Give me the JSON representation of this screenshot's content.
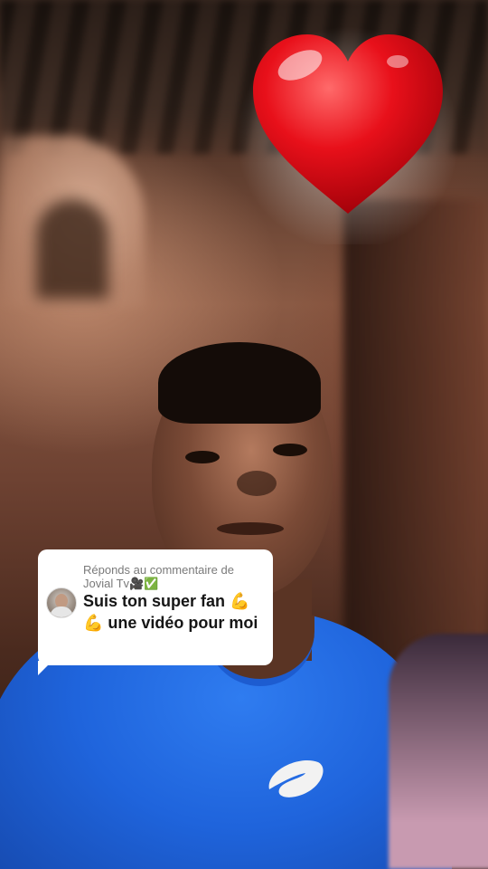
{
  "comment_reply": {
    "reply_prefix": "Réponds au commentaire de",
    "commenter_name": "Jovial Tv🎥✅",
    "comment_text": "Suis ton super fan 💪💪 une vidéo pour moi"
  },
  "stickers": {
    "heart_icon": "heart-icon",
    "heart_color": "#e8101a"
  },
  "colors": {
    "bubble_bg": "#ffffff",
    "comment_text": "#161616",
    "reply_text": "#7a7a7a",
    "shirt": "#1f64dc"
  }
}
